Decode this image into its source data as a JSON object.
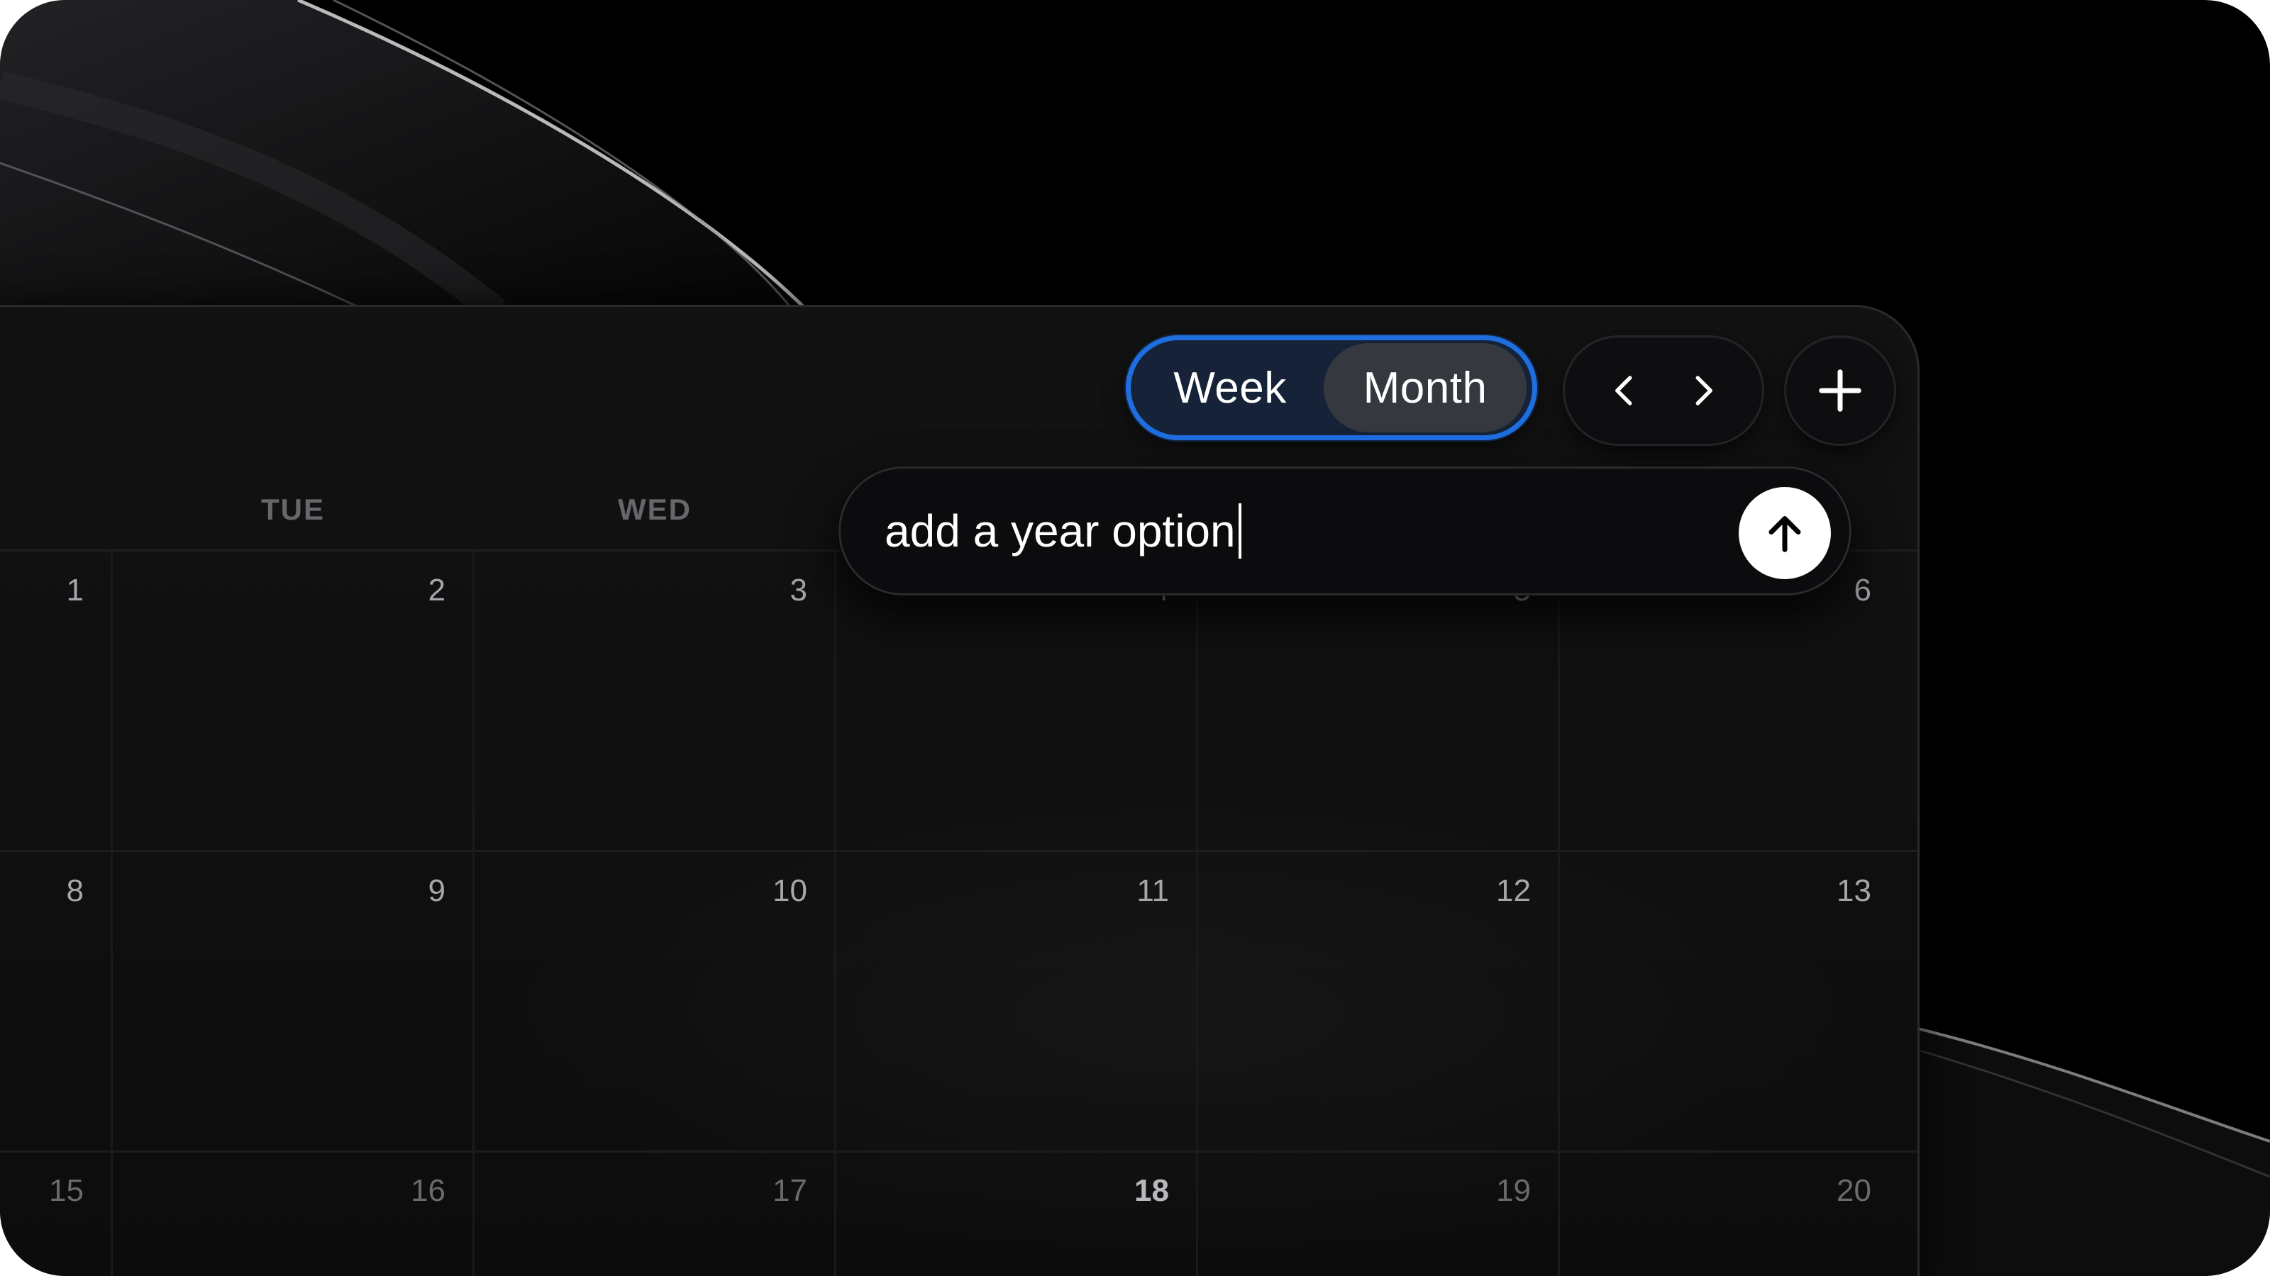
{
  "toolbar": {
    "view_options": [
      "Week",
      "Month"
    ],
    "selected_view": "Month",
    "prev_icon": "chevron-left-icon",
    "next_icon": "chevron-right-icon",
    "add_icon": "plus-icon"
  },
  "calendar": {
    "day_headers": [
      "TUE",
      "WED"
    ],
    "weeks": [
      [
        "1",
        "2",
        "3",
        "4",
        "5",
        "6"
      ],
      [
        "8",
        "9",
        "10",
        "11",
        "12",
        "13"
      ],
      [
        "15",
        "16",
        "17",
        "18",
        "19",
        "20"
      ]
    ]
  },
  "prompt": {
    "value": "add a year option",
    "send_icon": "arrow-up-icon"
  },
  "colors": {
    "accent": "#1f6ee0",
    "selected_segment": "#35393f",
    "background": "#000000",
    "surface": "#121213"
  }
}
